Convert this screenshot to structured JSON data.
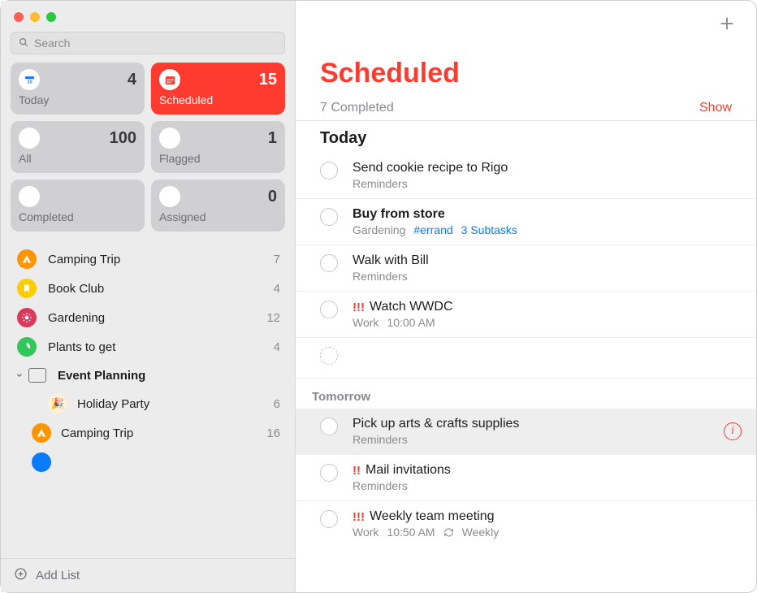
{
  "search": {
    "placeholder": "Search"
  },
  "tiles": {
    "today": {
      "label": "Today",
      "count": 4
    },
    "scheduled": {
      "label": "Scheduled",
      "count": 15
    },
    "all": {
      "label": "All",
      "count": 100
    },
    "flagged": {
      "label": "Flagged",
      "count": 1
    },
    "completed": {
      "label": "Completed"
    },
    "assigned": {
      "label": "Assigned",
      "count": 0
    }
  },
  "lists": {
    "camping": {
      "label": "Camping Trip",
      "count": 7
    },
    "book": {
      "label": "Book Club",
      "count": 4
    },
    "garden": {
      "label": "Gardening",
      "count": 12
    },
    "plants": {
      "label": "Plants to get",
      "count": 4
    },
    "eventPlanning": {
      "label": "Event Planning",
      "children": {
        "holiday": {
          "label": "Holiday Party",
          "count": 6,
          "emoji": "🎉"
        },
        "camping2": {
          "label": "Camping Trip",
          "count": 16
        }
      }
    }
  },
  "addList": {
    "label": "Add List"
  },
  "main": {
    "title": "Scheduled",
    "completedSummary": "7 Completed",
    "showLabel": "Show",
    "sections": {
      "today": {
        "header": "Today"
      },
      "tomorrow": {
        "header": "Tomorrow"
      }
    },
    "items": {
      "cookie": {
        "title": "Send cookie recipe to Rigo",
        "list": "Reminders"
      },
      "buyStore": {
        "title": "Buy from store",
        "list": "Gardening",
        "tag": "#errand",
        "subtasks": "3 Subtasks"
      },
      "walkBill": {
        "title": "Walk with Bill",
        "list": "Reminders"
      },
      "wwdc": {
        "priority": "!!!",
        "title": "Watch WWDC",
        "list": "Work",
        "time": "10:00 AM"
      },
      "arts": {
        "title": "Pick up arts & crafts supplies",
        "list": "Reminders"
      },
      "mail": {
        "priority": "!!",
        "title": "Mail invitations",
        "list": "Reminders"
      },
      "weekly": {
        "priority": "!!!",
        "title": "Weekly team meeting",
        "list": "Work",
        "time": "10:50 AM",
        "repeat": "Weekly"
      }
    }
  }
}
